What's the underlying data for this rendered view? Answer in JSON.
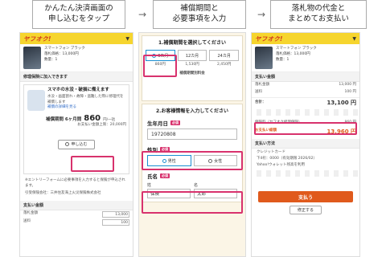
{
  "steps": [
    {
      "text": "かんたん決済画面の\n申し込むをタップ"
    },
    {
      "text": "補償期間と\n必要事項を入力"
    },
    {
      "text": "落札物の代金と\nまとめてお支払い"
    }
  ],
  "arrow": "→",
  "brand": {
    "logo": "ヤフオク!",
    "accent": "#f6d52e",
    "highlight": "#d8326d"
  },
  "product": {
    "name": "スマートフォン ブラック",
    "price": "落札価格：13,000円",
    "qty": "数量：1"
  },
  "panel1": {
    "section_title": "修理保険に加入できます",
    "box_title": "スマホの水没・破損に備えます",
    "desc": "水没・画面割れ・故障・盗難した際に修理代を補償します",
    "link": "補償の詳細を見る",
    "period_label": "補償期間 6ヶ月間",
    "price": "860",
    "price_unit": "円/一括",
    "price_note": "お支払い金額上限：20,000円",
    "apply_label": "申し込む",
    "fine_print": "※エントリーフォームに必要事項を入力すると保険が申込されます。",
    "insurer": "引受保険会社：三井住友海上火災保険株式会社",
    "pay_section": "支払い金額",
    "bid_label": "落札金額",
    "bid_value": "13,000",
    "ship_label": "送料",
    "ship_value": "100"
  },
  "panel2": {
    "q1": "1.補償期間を選択してください",
    "options": [
      "6カ月",
      "12カ月",
      "24カ月"
    ],
    "option_prices": [
      "860円",
      "1,530円",
      "2,450円"
    ],
    "plan_note": "補償期間別料金",
    "q2": "2.お客様情報を入力してください",
    "birth_label": "生年月日",
    "required": "必須",
    "birth_value": "19720808",
    "gender_label": "性別",
    "gender_options": [
      "男性",
      "女性"
    ],
    "name_label": "氏名",
    "last_label": "姓",
    "first_label": "名",
    "last_value": "保険",
    "first_value": "太郎"
  },
  "panel3": {
    "section_title": "支払い金額",
    "bid_label": "落札金額",
    "bid_value": "13,000 円",
    "ship_label": "送料",
    "ship_value": "100 円",
    "total_label": "合計：",
    "total_value": "13,100 円",
    "ins_label": "保険料（ヤフオク修理保険）",
    "ins_value": "860 円",
    "grand_label": "お支払い総額",
    "grand_value": "13,960 円",
    "method_title": "支払い方法",
    "card": "クレジットカード",
    "card_detail": "下4桁：0000（有効期限 2026/02）",
    "point_note": "Yahoo!ウォレット残高を利用",
    "pay_button": "支払う",
    "fix_button": "修正する"
  }
}
